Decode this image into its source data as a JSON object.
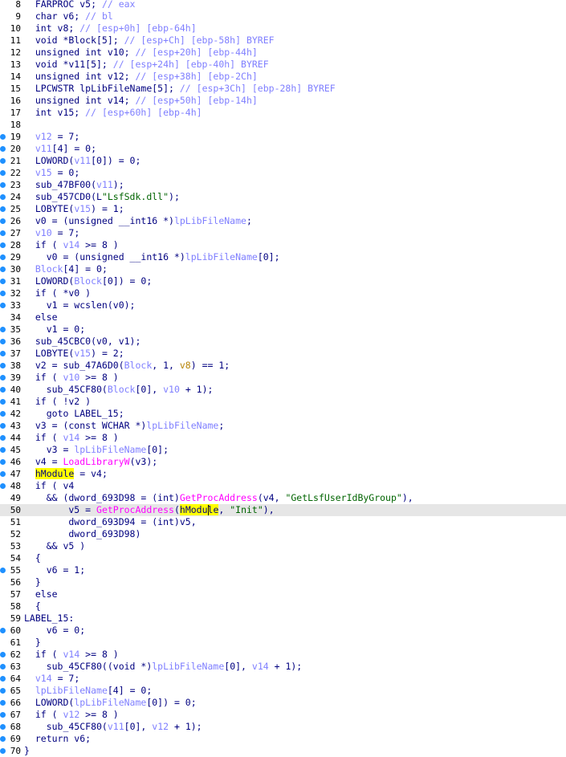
{
  "editor": {
    "current_line": 50,
    "lines": [
      {
        "n": "8",
        "bp": false,
        "t": [
          [
            "  FARPROC v5; ",
            "k"
          ],
          [
            "// eax",
            "c"
          ]
        ]
      },
      {
        "n": "9",
        "bp": false,
        "t": [
          [
            "  char v6; ",
            "k"
          ],
          [
            "// bl",
            "c"
          ]
        ]
      },
      {
        "n": "10",
        "bp": false,
        "t": [
          [
            "  int v8; ",
            "k"
          ],
          [
            "// [esp+0h] [ebp-64h]",
            "c"
          ]
        ]
      },
      {
        "n": "11",
        "bp": false,
        "t": [
          [
            "  void *Block[5]; ",
            "k"
          ],
          [
            "// [esp+Ch] [ebp-58h] BYREF",
            "c"
          ]
        ]
      },
      {
        "n": "12",
        "bp": false,
        "t": [
          [
            "  unsigned int v10; ",
            "k"
          ],
          [
            "// [esp+20h] [ebp-44h]",
            "c"
          ]
        ]
      },
      {
        "n": "13",
        "bp": false,
        "t": [
          [
            "  void *v11[5]; ",
            "k"
          ],
          [
            "// [esp+24h] [ebp-40h] BYREF",
            "c"
          ]
        ]
      },
      {
        "n": "14",
        "bp": false,
        "t": [
          [
            "  unsigned int v12; ",
            "k"
          ],
          [
            "// [esp+38h] [ebp-2Ch]",
            "c"
          ]
        ]
      },
      {
        "n": "15",
        "bp": false,
        "t": [
          [
            "  LPCWSTR lpLibFileName[5]; ",
            "k"
          ],
          [
            "// [esp+3Ch] [ebp-28h] BYREF",
            "c"
          ]
        ]
      },
      {
        "n": "16",
        "bp": false,
        "t": [
          [
            "  unsigned int v14; ",
            "k"
          ],
          [
            "// [esp+50h] [ebp-14h]",
            "c"
          ]
        ]
      },
      {
        "n": "17",
        "bp": false,
        "t": [
          [
            "  int v15; ",
            "k"
          ],
          [
            "// [esp+60h] [ebp-4h]",
            "c"
          ]
        ]
      },
      {
        "n": "18",
        "bp": false,
        "t": []
      },
      {
        "n": "19",
        "bp": true,
        "t": [
          [
            "  ",
            "k"
          ],
          [
            "v12",
            "v"
          ],
          [
            " = 7;",
            "k"
          ]
        ]
      },
      {
        "n": "20",
        "bp": true,
        "t": [
          [
            "  ",
            "k"
          ],
          [
            "v11",
            "v"
          ],
          [
            "[4] = 0;",
            "k"
          ]
        ]
      },
      {
        "n": "21",
        "bp": true,
        "t": [
          [
            "  LOWORD(",
            "k"
          ],
          [
            "v11",
            "v"
          ],
          [
            "[0]) = 0;",
            "k"
          ]
        ]
      },
      {
        "n": "22",
        "bp": true,
        "t": [
          [
            "  ",
            "k"
          ],
          [
            "v15",
            "v"
          ],
          [
            " = 0;",
            "k"
          ]
        ]
      },
      {
        "n": "23",
        "bp": true,
        "t": [
          [
            "  sub_47BF00(",
            "k"
          ],
          [
            "v11",
            "v"
          ],
          [
            ");",
            "k"
          ]
        ]
      },
      {
        "n": "24",
        "bp": true,
        "t": [
          [
            "  sub_457CD0(L",
            "k"
          ],
          [
            "\"LsfSdk.dll\"",
            "s"
          ],
          [
            ");",
            "k"
          ]
        ]
      },
      {
        "n": "25",
        "bp": true,
        "t": [
          [
            "  LOBYTE(",
            "k"
          ],
          [
            "v15",
            "v"
          ],
          [
            ") = 1;",
            "k"
          ]
        ]
      },
      {
        "n": "26",
        "bp": true,
        "t": [
          [
            "  v0 = (unsigned __int16 *)",
            "k"
          ],
          [
            "lpLibFileName",
            "v"
          ],
          [
            ";",
            "k"
          ]
        ]
      },
      {
        "n": "27",
        "bp": true,
        "t": [
          [
            "  ",
            "k"
          ],
          [
            "v10",
            "v"
          ],
          [
            " = 7;",
            "k"
          ]
        ]
      },
      {
        "n": "28",
        "bp": true,
        "t": [
          [
            "  if ( ",
            "k"
          ],
          [
            "v14",
            "v"
          ],
          [
            " >= 8 )",
            "k"
          ]
        ]
      },
      {
        "n": "29",
        "bp": true,
        "t": [
          [
            "    v0 = (unsigned __int16 *)",
            "k"
          ],
          [
            "lpLibFileName",
            "v"
          ],
          [
            "[0];",
            "k"
          ]
        ]
      },
      {
        "n": "30",
        "bp": true,
        "t": [
          [
            "  ",
            "k"
          ],
          [
            "Block",
            "v"
          ],
          [
            "[4] = 0;",
            "k"
          ]
        ]
      },
      {
        "n": "31",
        "bp": true,
        "t": [
          [
            "  LOWORD(",
            "k"
          ],
          [
            "Block",
            "v"
          ],
          [
            "[0]) = 0;",
            "k"
          ]
        ]
      },
      {
        "n": "32",
        "bp": true,
        "t": [
          [
            "  if ( *v0 )",
            "k"
          ]
        ]
      },
      {
        "n": "33",
        "bp": true,
        "t": [
          [
            "    v1 = wcslen(v0);",
            "k"
          ]
        ]
      },
      {
        "n": "34",
        "bp": false,
        "t": [
          [
            "  else",
            "k"
          ]
        ]
      },
      {
        "n": "35",
        "bp": true,
        "t": [
          [
            "    v1 = 0;",
            "k"
          ]
        ]
      },
      {
        "n": "36",
        "bp": true,
        "t": [
          [
            "  sub_45CBC0(v0, v1);",
            "k"
          ]
        ]
      },
      {
        "n": "37",
        "bp": true,
        "t": [
          [
            "  LOBYTE(",
            "k"
          ],
          [
            "v15",
            "v"
          ],
          [
            ") = 2;",
            "k"
          ]
        ]
      },
      {
        "n": "38",
        "bp": true,
        "t": [
          [
            "  v2 = sub_47A6D0(",
            "k"
          ],
          [
            "Block",
            "v"
          ],
          [
            ", 1, ",
            "k"
          ],
          [
            "v8",
            "a"
          ],
          [
            ") == 1;",
            "k"
          ]
        ]
      },
      {
        "n": "39",
        "bp": true,
        "t": [
          [
            "  if ( ",
            "k"
          ],
          [
            "v10",
            "v"
          ],
          [
            " >= 8 )",
            "k"
          ]
        ]
      },
      {
        "n": "40",
        "bp": true,
        "t": [
          [
            "    sub_45CF80(",
            "k"
          ],
          [
            "Block",
            "v"
          ],
          [
            "[0], ",
            "k"
          ],
          [
            "v10",
            "v"
          ],
          [
            " + 1);",
            "k"
          ]
        ]
      },
      {
        "n": "41",
        "bp": true,
        "t": [
          [
            "  if ( !v2 )",
            "k"
          ]
        ]
      },
      {
        "n": "42",
        "bp": true,
        "t": [
          [
            "    goto LABEL_15;",
            "k"
          ]
        ]
      },
      {
        "n": "43",
        "bp": true,
        "t": [
          [
            "  v3 = (const WCHAR *)",
            "k"
          ],
          [
            "lpLibFileName",
            "v"
          ],
          [
            ";",
            "k"
          ]
        ]
      },
      {
        "n": "44",
        "bp": true,
        "t": [
          [
            "  if ( ",
            "k"
          ],
          [
            "v14",
            "v"
          ],
          [
            " >= 8 )",
            "k"
          ]
        ]
      },
      {
        "n": "45",
        "bp": true,
        "t": [
          [
            "    v3 = ",
            "k"
          ],
          [
            "lpLibFileName",
            "v"
          ],
          [
            "[0];",
            "k"
          ]
        ]
      },
      {
        "n": "46",
        "bp": true,
        "t": [
          [
            "  v4 = ",
            "k"
          ],
          [
            "LoadLibraryW",
            "f"
          ],
          [
            "(v3);",
            "k"
          ]
        ]
      },
      {
        "n": "47",
        "bp": true,
        "t": [
          [
            "  ",
            "k"
          ],
          [
            "hModule",
            "h"
          ],
          [
            " = v4;",
            "k"
          ]
        ]
      },
      {
        "n": "48",
        "bp": true,
        "t": [
          [
            "  if ( v4",
            "k"
          ]
        ]
      },
      {
        "n": "49",
        "bp": false,
        "t": [
          [
            "    && (dword_693D98 = (int)",
            "k"
          ],
          [
            "GetProcAddress",
            "f"
          ],
          [
            "(v4, ",
            "k"
          ],
          [
            "\"GetLsfUserIdByGroup\"",
            "s"
          ],
          [
            "),",
            "k"
          ]
        ]
      },
      {
        "n": "50",
        "bp": false,
        "t": [
          [
            "        v5 = ",
            "k"
          ],
          [
            "GetProcAddress",
            "f"
          ],
          [
            "(",
            "k"
          ],
          [
            "hModule",
            "hc"
          ],
          [
            ", ",
            "k"
          ],
          [
            "\"Init\"",
            "s"
          ],
          [
            "),",
            "k"
          ]
        ]
      },
      {
        "n": "51",
        "bp": false,
        "t": [
          [
            "        dword_693D94 = (int)v5,",
            "k"
          ]
        ]
      },
      {
        "n": "52",
        "bp": false,
        "t": [
          [
            "        dword_693D98)",
            "k"
          ]
        ]
      },
      {
        "n": "53",
        "bp": false,
        "t": [
          [
            "    && v5 )",
            "k"
          ]
        ]
      },
      {
        "n": "54",
        "bp": false,
        "t": [
          [
            "  {",
            "k"
          ]
        ]
      },
      {
        "n": "55",
        "bp": true,
        "t": [
          [
            "    v6 = 1;",
            "k"
          ]
        ]
      },
      {
        "n": "56",
        "bp": false,
        "t": [
          [
            "  }",
            "k"
          ]
        ]
      },
      {
        "n": "57",
        "bp": false,
        "t": [
          [
            "  else",
            "k"
          ]
        ]
      },
      {
        "n": "58",
        "bp": false,
        "t": [
          [
            "  {",
            "k"
          ]
        ]
      },
      {
        "n": "59",
        "bp": false,
        "t": [
          [
            "LABEL_15:",
            "k"
          ]
        ]
      },
      {
        "n": "60",
        "bp": true,
        "t": [
          [
            "    v6 = 0;",
            "k"
          ]
        ]
      },
      {
        "n": "61",
        "bp": false,
        "t": [
          [
            "  }",
            "k"
          ]
        ]
      },
      {
        "n": "62",
        "bp": true,
        "t": [
          [
            "  if ( ",
            "k"
          ],
          [
            "v14",
            "v"
          ],
          [
            " >= 8 )",
            "k"
          ]
        ]
      },
      {
        "n": "63",
        "bp": true,
        "t": [
          [
            "    sub_45CF80((void *)",
            "k"
          ],
          [
            "lpLibFileName",
            "v"
          ],
          [
            "[0], ",
            "k"
          ],
          [
            "v14",
            "v"
          ],
          [
            " + 1);",
            "k"
          ]
        ]
      },
      {
        "n": "64",
        "bp": true,
        "t": [
          [
            "  ",
            "k"
          ],
          [
            "v14",
            "v"
          ],
          [
            " = 7;",
            "k"
          ]
        ]
      },
      {
        "n": "65",
        "bp": true,
        "t": [
          [
            "  ",
            "k"
          ],
          [
            "lpLibFileName",
            "v"
          ],
          [
            "[4] = 0;",
            "k"
          ]
        ]
      },
      {
        "n": "66",
        "bp": true,
        "t": [
          [
            "  LOWORD(",
            "k"
          ],
          [
            "lpLibFileName",
            "v"
          ],
          [
            "[0]) = 0;",
            "k"
          ]
        ]
      },
      {
        "n": "67",
        "bp": true,
        "t": [
          [
            "  if ( ",
            "k"
          ],
          [
            "v12",
            "v"
          ],
          [
            " >= 8 )",
            "k"
          ]
        ]
      },
      {
        "n": "68",
        "bp": true,
        "t": [
          [
            "    sub_45CF80(",
            "k"
          ],
          [
            "v11",
            "v"
          ],
          [
            "[0], ",
            "k"
          ],
          [
            "v12",
            "v"
          ],
          [
            " + 1);",
            "k"
          ]
        ]
      },
      {
        "n": "69",
        "bp": true,
        "t": [
          [
            "  return v6;",
            "k"
          ]
        ]
      },
      {
        "n": "70",
        "bp": true,
        "t": [
          [
            "}",
            "k"
          ]
        ]
      }
    ]
  },
  "colors": {
    "background": "#ffffff",
    "current_line_bg": "#e6e6e6",
    "keyword": "#000080",
    "variable": "#7f7fff",
    "comment": "#7f7fff",
    "argument": "#b8860b",
    "function": "#ff00ff",
    "string": "#006400",
    "highlight": "#ffff00",
    "breakpoint_dot": "#1e90ff"
  }
}
